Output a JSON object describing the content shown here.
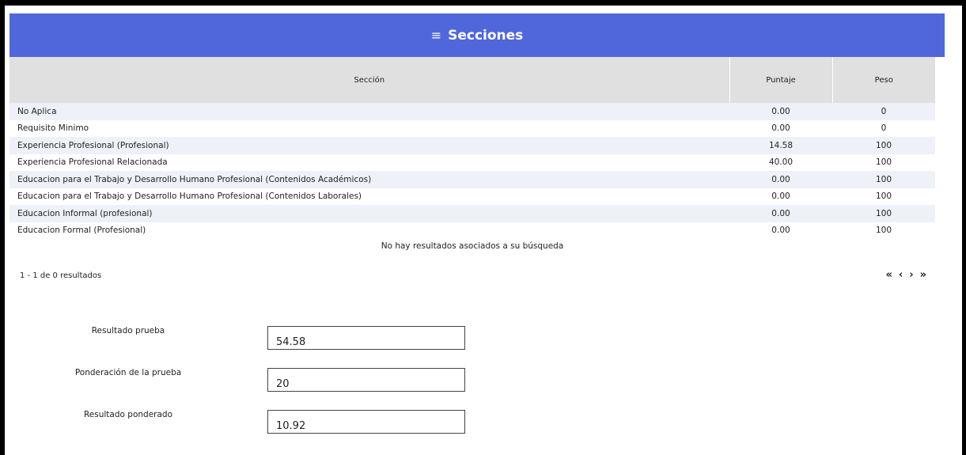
{
  "header": {
    "title": "Secciones",
    "icon": "menu-icon"
  },
  "table": {
    "columns": [
      "Sección",
      "Puntaje",
      "Peso"
    ],
    "rows": [
      {
        "seccion": "No Aplica",
        "puntaje": "0.00",
        "peso": "0"
      },
      {
        "seccion": "Requisito Minimo",
        "puntaje": "0.00",
        "peso": "0"
      },
      {
        "seccion": "Experiencia Profesional (Profesional)",
        "puntaje": "14.58",
        "peso": "100"
      },
      {
        "seccion": "Experiencia Profesional Relacionada",
        "puntaje": "40.00",
        "peso": "100"
      },
      {
        "seccion": "Educacion para el Trabajo y Desarrollo Humano Profesional (Contenidos Académicos)",
        "puntaje": "0.00",
        "peso": "100"
      },
      {
        "seccion": "Educacion para el Trabajo y Desarrollo Humano Profesional (Contenidos Laborales)",
        "puntaje": "0.00",
        "peso": "100"
      },
      {
        "seccion": "Educacion Informal (profesional)",
        "puntaje": "0.00",
        "peso": "100"
      },
      {
        "seccion": "Educacion Formal (Profesional)",
        "puntaje": "0.00",
        "peso": "100"
      }
    ],
    "empty_message": "No hay resultados asociados a su búsqueda"
  },
  "pagination": {
    "summary": "1 - 1 de 0 resultados",
    "first": "«",
    "prev": "‹",
    "next": "›",
    "last": "»"
  },
  "form": {
    "resultado_prueba": {
      "label": "Resultado prueba",
      "value": "54.58"
    },
    "ponderacion": {
      "label": "Ponderación de la prueba",
      "value": "20"
    },
    "resultado_ponderado": {
      "label": "Resultado ponderado",
      "value": "10.92"
    }
  },
  "colors": {
    "header_bg": "#5067dc",
    "table_header_bg": "#e0e0e0",
    "row_stripe": "#eef1f7"
  }
}
